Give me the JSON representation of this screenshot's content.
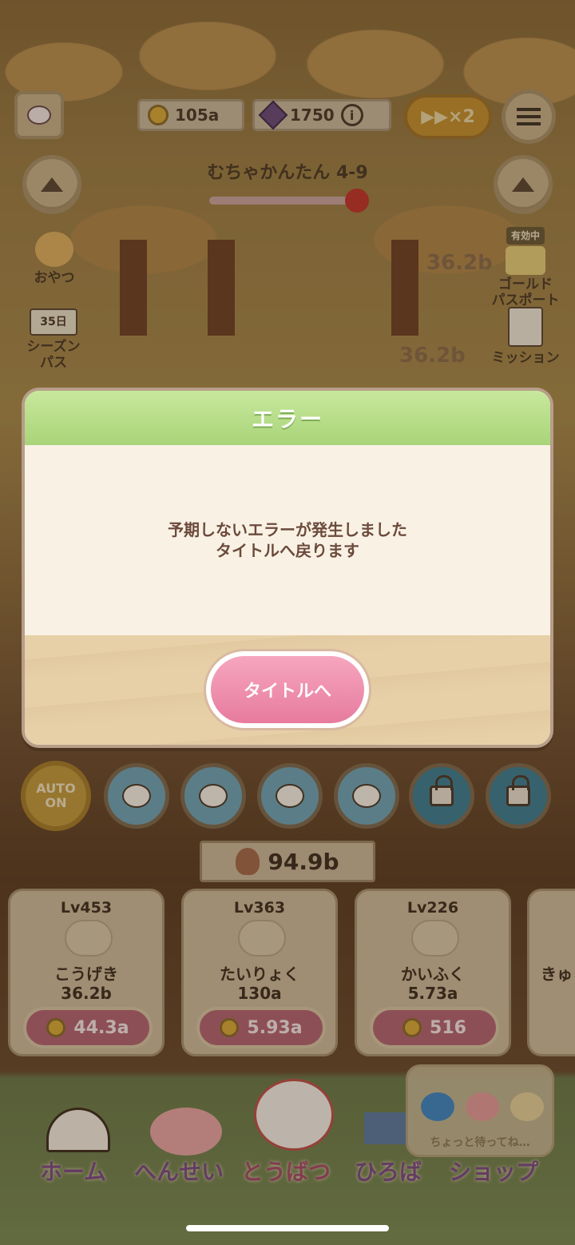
{
  "header": {
    "coins": "105a",
    "gems": "1750",
    "speed_label": "▶▶×2",
    "stage_title": "むちゃかんたん 4-9"
  },
  "side_left": {
    "snack_label": "おやつ",
    "season_days": "35日",
    "season_label_1": "シーズン",
    "season_label_2": "パス"
  },
  "side_right": {
    "active_badge": "有効中",
    "gold_label_1": "ゴールド",
    "gold_label_2": "パスポート",
    "mission_label": "ミッション"
  },
  "floats": [
    "36.2b",
    "36.2b"
  ],
  "dialog": {
    "title": "エラー",
    "message_line1": "予期しないエラーが発生しました",
    "message_line2": "タイトルへ戻ります",
    "button_label": "タイトルへ"
  },
  "auto_button": {
    "line1": "AUTO",
    "line2": "ON"
  },
  "power": "94.9b",
  "cards": [
    {
      "level": "Lv453",
      "name": "こうげき",
      "value": "36.2b",
      "cost": "44.3a"
    },
    {
      "level": "Lv363",
      "name": "たいりょく",
      "value": "130a",
      "cost": "5.93a"
    },
    {
      "level": "Lv226",
      "name": "かいふく",
      "value": "5.73a",
      "cost": "516"
    },
    {
      "level": "",
      "name": "きゅ",
      "value": "",
      "cost": ""
    }
  ],
  "nav": {
    "home": "ホーム",
    "henshin": "へんせい",
    "toubatsu": "とうばつ",
    "hiroba": "ひろば",
    "shop": "ショップ",
    "waiting": "ちょっと待ってね…"
  },
  "colors": {
    "accent_pink": "#e77b9e",
    "header_green": "#a9d479",
    "dialog_bg": "#f9f2e4"
  }
}
